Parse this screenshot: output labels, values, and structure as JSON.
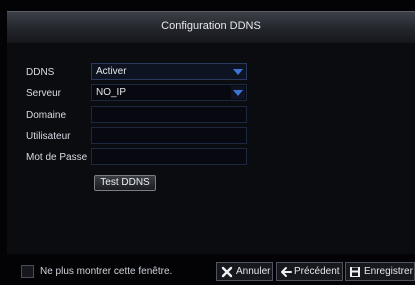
{
  "dialog": {
    "title": "Configuration DDNS"
  },
  "form": {
    "ddns": {
      "label": "DDNS",
      "value": "Activer"
    },
    "server": {
      "label": "Serveur",
      "value": "NO_IP"
    },
    "domain": {
      "label": "Domaine",
      "value": ""
    },
    "user": {
      "label": "Utilisateur",
      "value": ""
    },
    "password": {
      "label": "Mot de Passe",
      "value": ""
    },
    "test_label": "Test DDNS"
  },
  "footer": {
    "dont_show_label": "Ne plus montrer cette fenêtre.",
    "cancel_label": "Annuler",
    "previous_label": "Précédent",
    "save_label": "Enregistrer"
  },
  "colors": {
    "dropdown_arrow": "#3d74d6",
    "field_border": "#1c2740"
  }
}
